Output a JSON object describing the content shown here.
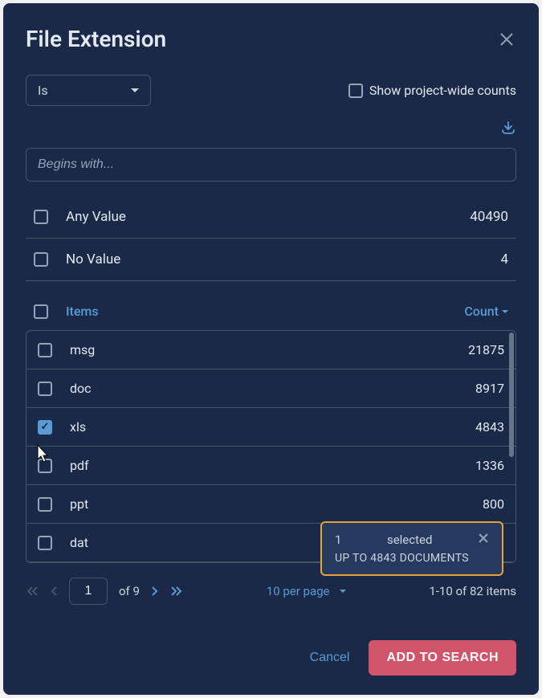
{
  "dialog": {
    "title": "File Extension"
  },
  "operator": {
    "selected": "Is"
  },
  "show_counts": {
    "label": "Show project-wide counts"
  },
  "search": {
    "placeholder": "Begins with..."
  },
  "any_value": {
    "label": "Any Value",
    "count": "40490"
  },
  "no_value": {
    "label": "No Value",
    "count": "4"
  },
  "items_header": {
    "label": "Items",
    "count_label": "Count"
  },
  "items": [
    {
      "label": "msg",
      "count": "21875",
      "checked": false
    },
    {
      "label": "doc",
      "count": "8917",
      "checked": false
    },
    {
      "label": "xls",
      "count": "4843",
      "checked": true
    },
    {
      "label": "pdf",
      "count": "1336",
      "checked": false
    },
    {
      "label": "ppt",
      "count": "800",
      "checked": false
    },
    {
      "label": "dat",
      "count": "",
      "checked": false
    }
  ],
  "toast": {
    "count": "1",
    "selected_label": "selected",
    "documents_line": "UP TO 4843 DOCUMENTS"
  },
  "pagination": {
    "page": "1",
    "of_label": "of 9",
    "per_page": "10 per page",
    "range": "1-10 of 82 items"
  },
  "footer": {
    "cancel": "Cancel",
    "submit": "ADD TO SEARCH"
  }
}
